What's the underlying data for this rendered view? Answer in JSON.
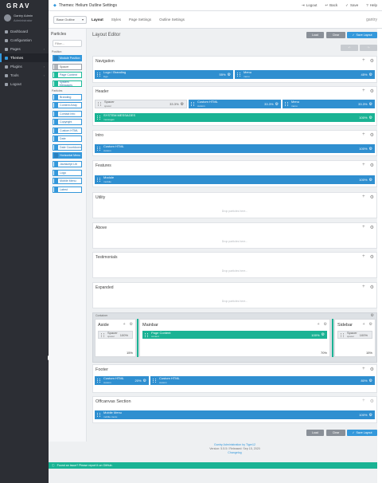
{
  "brand": {
    "logo": "GRAV"
  },
  "user": {
    "name": "Gantry Admin",
    "role": "Administrator"
  },
  "sidebar": {
    "items": [
      {
        "label": "Dashboard",
        "icon": "dashboard-icon"
      },
      {
        "label": "Configuration",
        "icon": "wrench-icon"
      },
      {
        "label": "Pages",
        "icon": "file-icon"
      },
      {
        "label": "Themes",
        "icon": "tint-icon",
        "active": true
      },
      {
        "label": "Plugins",
        "icon": "plug-icon"
      },
      {
        "label": "Tools",
        "icon": "briefcase-icon"
      },
      {
        "label": "Logout",
        "icon": "sign-out-icon"
      }
    ]
  },
  "topbar": {
    "title": "Themes: Helium Outline Settings",
    "actions": [
      "Logout",
      "Back",
      "Save",
      "Help"
    ]
  },
  "subbar": {
    "outline_select": "Base Outline",
    "tabs": [
      "Layout",
      "Styles",
      "Page Settings",
      "Outline Settings"
    ],
    "right": "gantry"
  },
  "particles": {
    "title": "Particles",
    "search_placeholder": "Filter...",
    "groups": [
      {
        "label": "Position",
        "items": [
          {
            "label": "Module Position",
            "variant": "blue"
          },
          {
            "label": "Spacer",
            "variant": "gray"
          },
          {
            "label": "Page Content",
            "variant": "green"
          },
          {
            "label": "System Messages",
            "variant": "green"
          }
        ]
      },
      {
        "label": "Particles",
        "items": [
          {
            "label": "Branding",
            "variant": "default"
          },
          {
            "label": "Content Array",
            "variant": "default"
          },
          {
            "label": "Contact Info",
            "variant": "default"
          },
          {
            "label": "Copyright",
            "variant": "default"
          },
          {
            "label": "Custom HTML",
            "variant": "default"
          },
          {
            "label": "Date",
            "variant": "default"
          },
          {
            "label": "Date Countdown",
            "variant": "default"
          },
          {
            "label": "Horizontal Menu",
            "variant": "default"
          }
        ]
      },
      {
        "label": "",
        "items": [
          {
            "label": "Javascript Lib",
            "variant": "default"
          },
          {
            "label": "Logo",
            "variant": "default"
          },
          {
            "label": "Mobile Menu",
            "variant": "default"
          },
          {
            "label": "Latest",
            "variant": "default"
          }
        ]
      }
    ]
  },
  "layout": {
    "title": "Layout Editor",
    "buttons": {
      "load": "Load",
      "clear": "Clear",
      "save_layout": "Save Layout"
    }
  },
  "sections": [
    {
      "name": "Navigation",
      "blocks": [
        {
          "title": "Logo / Branding",
          "sub": "logo",
          "pct": "55%",
          "variant": "blue"
        },
        {
          "title": "Menu",
          "sub": "menu",
          "pct": "45%",
          "variant": "blue"
        }
      ]
    },
    {
      "name": "Header",
      "rows": [
        [
          {
            "title": "Spacer",
            "sub": "spacer",
            "pct": "33.3%",
            "variant": "gray"
          },
          {
            "title": "Custom HTML",
            "sub": "custom",
            "pct": "33.3%",
            "variant": "blue"
          },
          {
            "title": "Menu",
            "sub": "menu",
            "pct": "33.3%",
            "variant": "blue"
          }
        ],
        [
          {
            "title": "SYSTEM MESSAGES",
            "sub": "messages",
            "pct": "100%",
            "variant": "teal"
          }
        ]
      ]
    },
    {
      "name": "Intro",
      "blocks": [
        {
          "title": "Custom HTML",
          "sub": "custom",
          "pct": "100%",
          "variant": "blue"
        }
      ]
    },
    {
      "name": "Features",
      "blocks": [
        {
          "title": "Module",
          "sub": "module",
          "pct": "100%",
          "variant": "blue"
        }
      ]
    },
    {
      "name": "Utility",
      "drop": "Drop particles here..."
    },
    {
      "name": "Above",
      "drop": "Drop particles here..."
    },
    {
      "name": "Testimonials",
      "drop": "Drop particles here..."
    },
    {
      "name": "Expanded",
      "drop": "Drop particles here..."
    }
  ],
  "container": {
    "label": "Container",
    "columns": [
      {
        "name": "Aside",
        "pct": "15%",
        "block": {
          "title": "Spacer",
          "sub": "spacer",
          "pct": "100%",
          "variant": "gray"
        }
      },
      {
        "name": "Mainbar",
        "pct": "70%",
        "block": {
          "title": "Page Content",
          "sub": "content",
          "pct": "100%",
          "variant": "teal"
        }
      },
      {
        "name": "Sidebar",
        "pct": "15%",
        "block": {
          "title": "Spacer",
          "sub": "spacer",
          "pct": "100%",
          "variant": "gray"
        }
      }
    ]
  },
  "footer_section": {
    "name": "Footer",
    "blocks": [
      {
        "title": "Custom HTML",
        "sub": "custom",
        "pct": "20%",
        "variant": "blue"
      },
      {
        "title": "Custom HTML",
        "sub": "custom",
        "pct": "80%",
        "variant": "blue"
      }
    ]
  },
  "offcanvas": {
    "name": "Offcanvas Section",
    "blocks": [
      {
        "title": "Mobile Menu",
        "sub": "mobile-menu",
        "pct": "100%",
        "variant": "blue"
      }
    ]
  },
  "footer": {
    "line1": "Gantry Administration by Tiger12",
    "line2": "Version: 5.5.5 / Released: Sep 15, 2020",
    "line3": "Changelog"
  },
  "notice": {
    "text": "Found an issue? Please report it on GitHub."
  },
  "colors": {
    "accent": "#3498db",
    "teal": "#1ab394",
    "sidebar": "#2c2e34"
  }
}
